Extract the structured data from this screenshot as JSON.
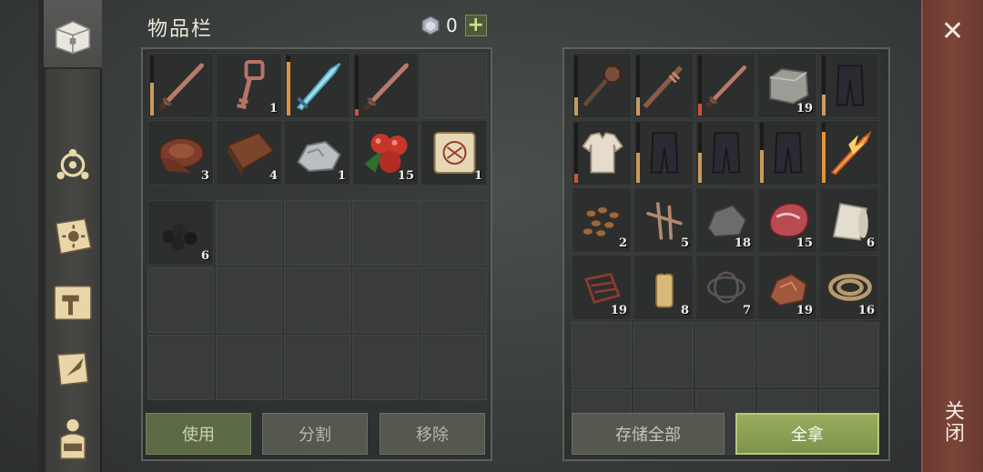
{
  "inventory": {
    "title": "物品栏",
    "currency": "0",
    "slots": [
      {
        "icon": "sword-icon",
        "qty": "",
        "durability": 0.55,
        "dur_color": "#c99a5f"
      },
      {
        "icon": "key-icon",
        "qty": "1"
      },
      {
        "icon": "ice-sword-icon",
        "qty": "",
        "durability": 0.9,
        "dur_color": "#e3923c"
      },
      {
        "icon": "sword-icon",
        "qty": "",
        "durability": 0.1,
        "dur_color": "#c8553d"
      },
      {
        "icon": "",
        "qty": ""
      },
      {
        "icon": "leather-roll-icon",
        "qty": "3"
      },
      {
        "icon": "leather-sheet-icon",
        "qty": "4"
      },
      {
        "icon": "stone-ore-icon",
        "qty": "1"
      },
      {
        "icon": "berries-icon",
        "qty": "15"
      },
      {
        "icon": "scroll-map-icon",
        "qty": "1"
      }
    ],
    "backpack": [
      {
        "icon": "coal-icon",
        "qty": "6"
      },
      {
        "icon": "",
        "qty": ""
      },
      {
        "icon": "",
        "qty": ""
      },
      {
        "icon": "",
        "qty": ""
      },
      {
        "icon": "",
        "qty": ""
      },
      {
        "icon": "",
        "qty": ""
      },
      {
        "icon": "",
        "qty": ""
      },
      {
        "icon": "",
        "qty": ""
      },
      {
        "icon": "",
        "qty": ""
      },
      {
        "icon": "",
        "qty": ""
      },
      {
        "icon": "",
        "qty": ""
      },
      {
        "icon": "",
        "qty": ""
      },
      {
        "icon": "",
        "qty": ""
      },
      {
        "icon": "",
        "qty": ""
      },
      {
        "icon": "",
        "qty": ""
      }
    ],
    "buttons": {
      "use": "使用",
      "split": "分割",
      "remove": "移除"
    }
  },
  "container": {
    "slots": [
      {
        "icon": "mace-icon",
        "qty": "",
        "durability": 0.3,
        "dur_color": "#c99a5f"
      },
      {
        "icon": "spiked-club-icon",
        "qty": "",
        "durability": 0.3,
        "dur_color": "#c99a5f"
      },
      {
        "icon": "sword-icon",
        "qty": "",
        "durability": 0.2,
        "dur_color": "#c8553d"
      },
      {
        "icon": "stone-block-icon",
        "qty": "19"
      },
      {
        "icon": "pants-icon",
        "qty": "",
        "durability": 0.35,
        "dur_color": "#c99a5f"
      },
      {
        "icon": "shirt-icon",
        "qty": "",
        "durability": 0.15,
        "dur_color": "#c8553d"
      },
      {
        "icon": "pants-icon",
        "qty": "",
        "durability": 0.5,
        "dur_color": "#c99a5f"
      },
      {
        "icon": "pants-icon",
        "qty": "",
        "durability": 0.5,
        "dur_color": "#c99a5f"
      },
      {
        "icon": "pants-icon",
        "qty": "",
        "durability": 0.55,
        "dur_color": "#c99a5f"
      },
      {
        "icon": "fire-sword-icon",
        "qty": "",
        "durability": 0.85,
        "dur_color": "#e3923c"
      },
      {
        "icon": "seeds-icon",
        "qty": "2"
      },
      {
        "icon": "nails-icon",
        "qty": "5"
      },
      {
        "icon": "rock-icon",
        "qty": "18"
      },
      {
        "icon": "raw-meat-icon",
        "qty": "15"
      },
      {
        "icon": "cloth-roll-icon",
        "qty": "6"
      },
      {
        "icon": "scrap-icon",
        "qty": "19"
      },
      {
        "icon": "candle-icon",
        "qty": "8"
      },
      {
        "icon": "string-icon",
        "qty": "7"
      },
      {
        "icon": "copper-ore-icon",
        "qty": "19"
      },
      {
        "icon": "rope-icon",
        "qty": "16"
      },
      {
        "icon": "",
        "qty": ""
      },
      {
        "icon": "",
        "qty": ""
      },
      {
        "icon": "",
        "qty": ""
      },
      {
        "icon": "",
        "qty": ""
      },
      {
        "icon": "",
        "qty": ""
      },
      {
        "icon": "",
        "qty": ""
      },
      {
        "icon": "",
        "qty": ""
      },
      {
        "icon": "",
        "qty": ""
      },
      {
        "icon": "",
        "qty": ""
      },
      {
        "icon": "",
        "qty": ""
      }
    ],
    "buttons": {
      "store_all": "存储全部",
      "take_all": "全拿"
    }
  },
  "close": {
    "label": "关闭"
  },
  "sidebar": [
    "chest-icon",
    "hub-icon",
    "sun-book-icon",
    "hammer-icon",
    "quill-scroll-icon",
    "backpack-icon"
  ]
}
